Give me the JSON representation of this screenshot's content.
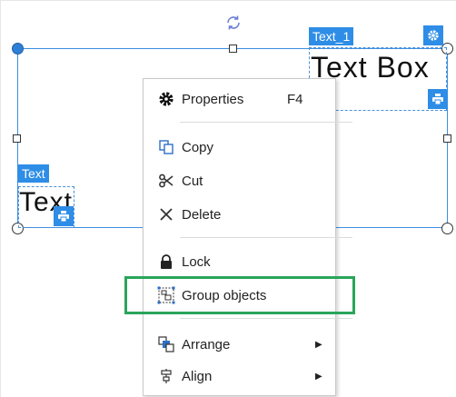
{
  "objects": {
    "text_box_tag": "Text_1",
    "text_box_content": "Text Box",
    "text_tag": "Text",
    "text_content": "Text"
  },
  "context_menu": {
    "items": [
      {
        "label": "Properties",
        "shortcut": "F4",
        "icon": "gear-icon"
      },
      {
        "label": "Copy",
        "icon": "copy-icon"
      },
      {
        "label": "Cut",
        "icon": "scissors-icon"
      },
      {
        "label": "Delete",
        "icon": "close-icon"
      },
      {
        "label": "Lock",
        "icon": "lock-icon"
      },
      {
        "label": "Group objects",
        "icon": "group-icon"
      },
      {
        "label": "Arrange",
        "icon": "arrange-icon",
        "submenu": "▶"
      },
      {
        "label": "Align",
        "icon": "align-icon",
        "submenu": "▶"
      }
    ]
  },
  "colors": {
    "accent": "#2e8de6",
    "highlight": "#2aa55a",
    "selection": "#3b8fe0"
  }
}
